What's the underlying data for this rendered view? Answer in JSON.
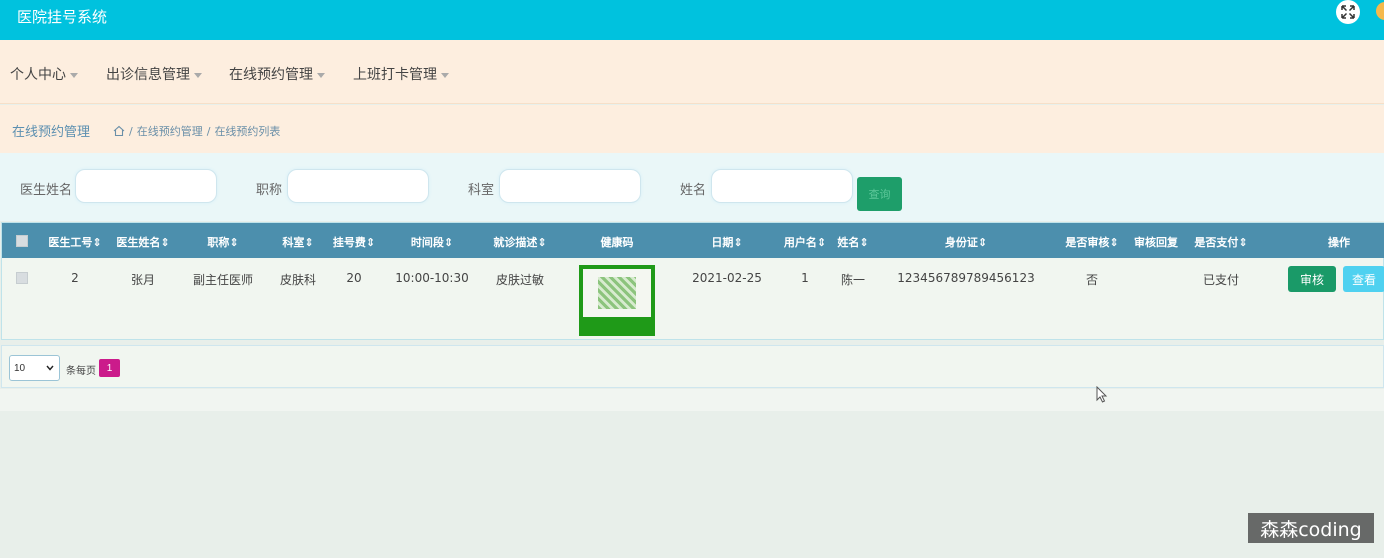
{
  "header": {
    "title": "医院挂号系统",
    "fullscreen_icon": "expand-icon"
  },
  "nav": [
    {
      "label": "个人中心"
    },
    {
      "label": "出诊信息管理"
    },
    {
      "label": "在线预约管理"
    },
    {
      "label": "上班打卡管理"
    }
  ],
  "breadcrumb": {
    "page_title": "在线预约管理",
    "home_icon": "home-icon",
    "path": [
      "在线预约管理",
      "在线预约列表"
    ],
    "sep": "/"
  },
  "search": {
    "fields": [
      {
        "label": "医生姓名",
        "value": ""
      },
      {
        "label": "职称",
        "value": ""
      },
      {
        "label": "科室",
        "value": ""
      },
      {
        "label": "姓名",
        "value": ""
      }
    ],
    "button_label": "查询"
  },
  "table": {
    "columns": [
      "医生工号",
      "医生姓名",
      "职称",
      "科室",
      "挂号费",
      "时间段",
      "就诊描述",
      "健康码",
      "日期",
      "用户名",
      "姓名",
      "身份证",
      "是否审核",
      "审核回复",
      "是否支付",
      "操作"
    ],
    "rows": [
      {
        "doctor_id": "2",
        "doctor_name": "张月",
        "title": "副主任医师",
        "department": "皮肤科",
        "fee": "20",
        "time_slot": "10:00-10:30",
        "description": "皮肤过敏",
        "health_code": "qr-image",
        "date": "2021-02-25",
        "username": "1",
        "name": "陈一",
        "id_card": "123456789789456123",
        "reviewed": "否",
        "review_reply": "",
        "paid": "已支付",
        "actions": [
          "审核",
          "查看"
        ]
      }
    ]
  },
  "pager": {
    "page_size": "10",
    "per_page_label": "条每页",
    "current_page": "1"
  },
  "watermark": "森森coding",
  "colors": {
    "topbar": "#00c2de",
    "nav_bg": "#fdeedf",
    "table_header": "#4c8fad",
    "review_btn": "#1a9a68",
    "view_btn": "#4fd1f0",
    "page_active": "#cb1b8b"
  }
}
